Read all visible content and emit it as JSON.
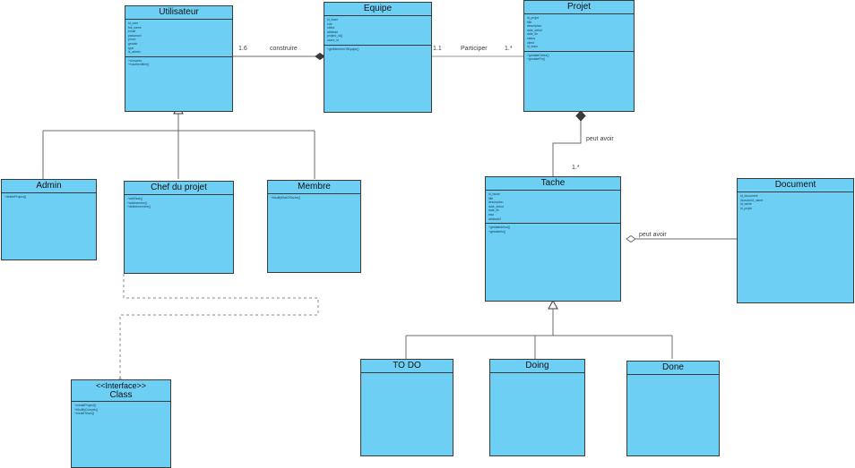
{
  "diagram": {
    "title": "Class Diagram",
    "box_fill": "#6ecff5",
    "box_border": "#3a3a3a",
    "line_color": "#6b6b6b",
    "text_color": "#123c55"
  },
  "classes": {
    "utilisateur": {
      "name": "Utilisateur",
      "attributes": [
        "id_user",
        "full_name",
        "email",
        "password",
        "photo",
        "gender",
        "type",
        "is_admin"
      ],
      "operations": [
        "+s'inscrire",
        "+s'authentifier()"
      ]
    },
    "equipe": {
      "name": "Equipe",
      "attributes": [
        "id_team",
        "role",
        "statut",
        "attribute",
        "project_id()",
        "users_id"
      ],
      "operations": [
        "+getMembreOfEquipe()"
      ]
    },
    "projet": {
      "name": "Projet",
      "attributes": [
        "id_projet",
        "title",
        "description",
        "date_debut",
        "date_fin",
        "status",
        "client",
        "id_team"
      ],
      "operations": [
        "+getdateDebut()",
        "+getdateFin()"
      ]
    },
    "admin": {
      "name": "Admin",
      "attributes": [],
      "operations": [
        "+deleteProject()"
      ]
    },
    "chef": {
      "name": "Chef du projet",
      "attributes": [],
      "operations": [
        "+addTask()",
        "+addmembre()",
        "+deletemembre()"
      ]
    },
    "membre": {
      "name": "Membre",
      "attributes": [],
      "operations": [
        "+ModifyEtatOfTache()"
      ]
    },
    "tache": {
      "name": "Tache",
      "attributes": [
        "id_tache",
        "title",
        "description",
        "date_debut",
        "date_fin",
        "etat",
        "attribute2"
      ],
      "operations": [
        "+getdatedebut()",
        "+getdatefin()"
      ]
    },
    "document": {
      "name": "Document",
      "attributes": [
        "id_document",
        "document_name",
        "id_tache",
        "id_projet"
      ],
      "operations": []
    },
    "interface": {
      "stereotype": "<<Interface>>",
      "name": "Class",
      "attributes": [],
      "operations": [
        "+createProject()",
        "+ModifyCompte()",
        "+createTeam()"
      ]
    },
    "todo": {
      "name": "TO DO",
      "attributes": [],
      "operations": []
    },
    "doing": {
      "name": "Doing",
      "attributes": [],
      "operations": []
    },
    "done": {
      "name": "Done",
      "attributes": [],
      "operations": []
    }
  },
  "relations": {
    "construire": {
      "label": "construire",
      "source_mult": "1.6"
    },
    "participer": {
      "label": "Participer",
      "source_mult": "1.1",
      "target_mult": "1.*"
    },
    "projet_tache": {
      "label": "peut avoir",
      "target_mult": "1.*"
    },
    "tache_document": {
      "label": "peut avoir"
    }
  }
}
